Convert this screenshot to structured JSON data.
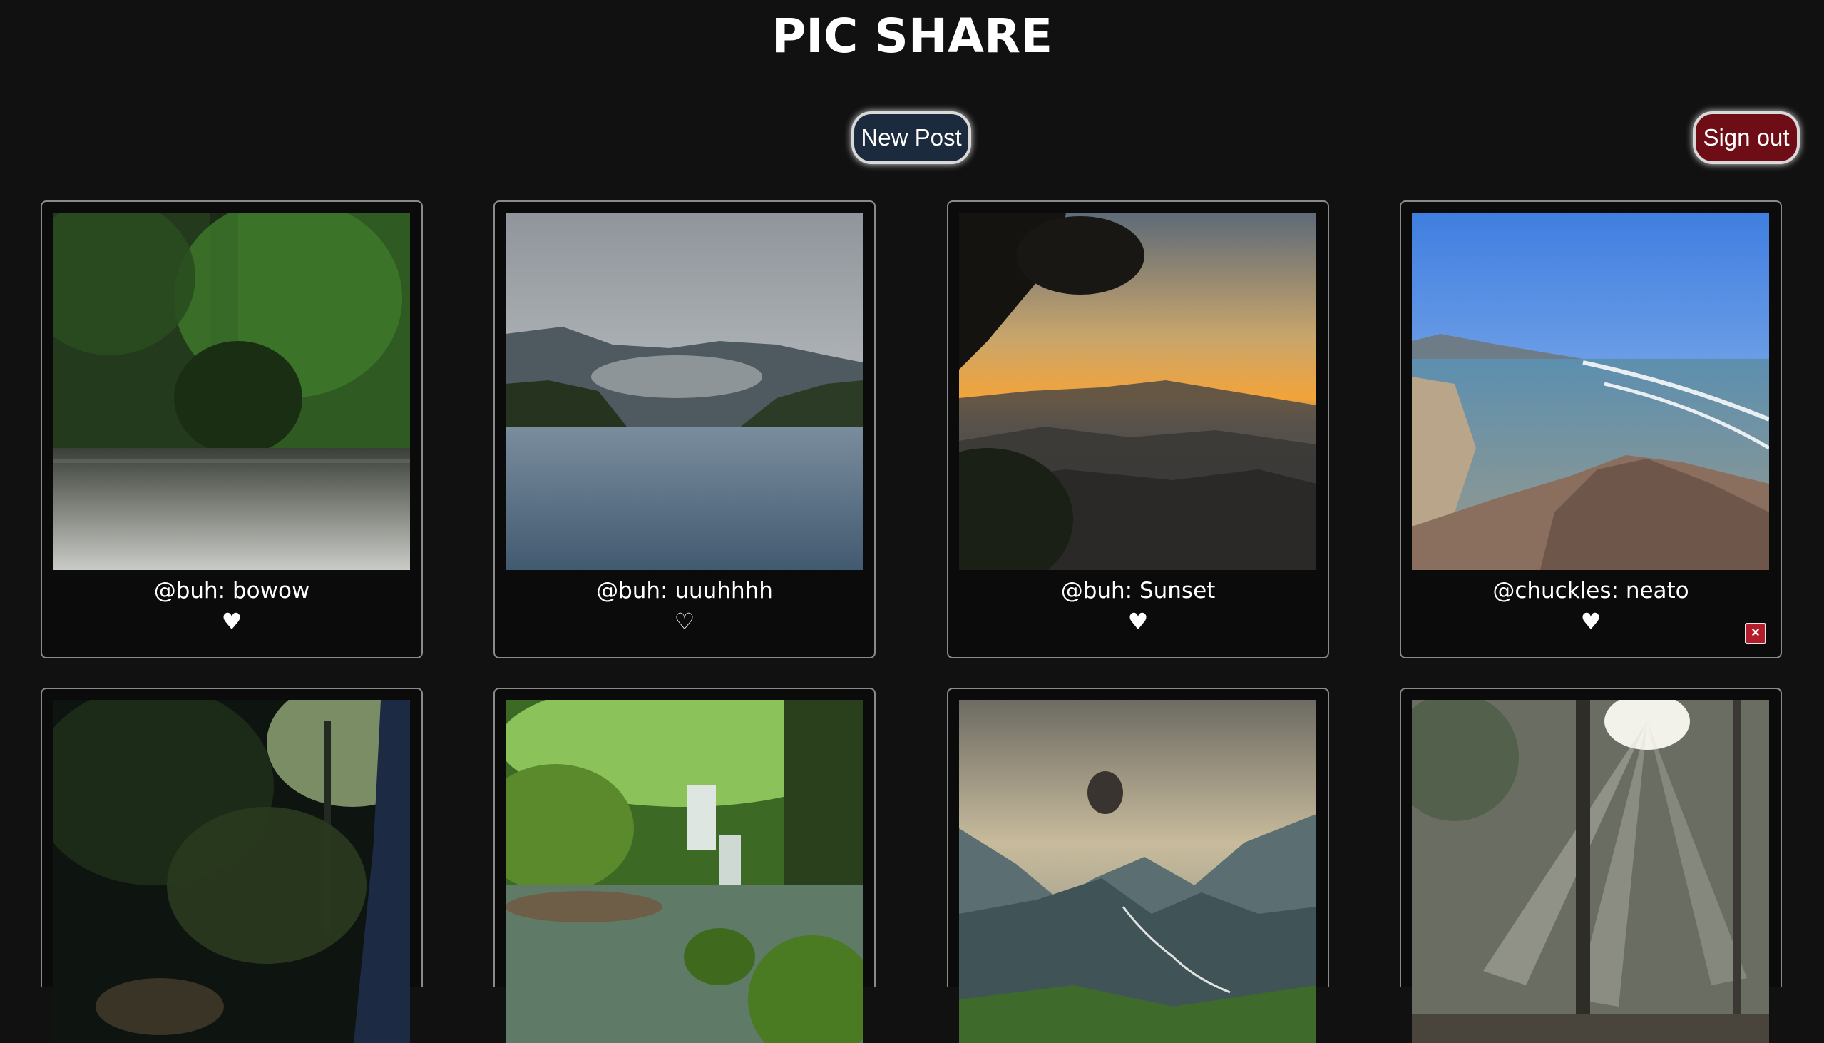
{
  "header": {
    "title": "PIC SHARE"
  },
  "toolbar": {
    "new_post_label": "New Post",
    "sign_out_label": "Sign out"
  },
  "posts": [
    {
      "caption": "@buh: bowow",
      "liked": true,
      "heart": "♥",
      "scene": "jungle river"
    },
    {
      "caption": "@buh: uuuhhhh",
      "liked": false,
      "heart": "♡",
      "scene": "misty lake"
    },
    {
      "caption": "@buh: Sunset",
      "liked": true,
      "heart": "♥",
      "scene": "mountain sunset"
    },
    {
      "caption": "@chuckles: neato",
      "liked": true,
      "heart": "♥",
      "scene": "coastal beach",
      "delete_label": "×"
    },
    {
      "caption": "",
      "scene": "dark forest path"
    },
    {
      "caption": "",
      "scene": "mossy waterfall"
    },
    {
      "caption": "",
      "scene": "valley with sun rays"
    },
    {
      "caption": "",
      "scene": "forest with light beams"
    }
  ],
  "colors": {
    "background": "#111111",
    "new_post_button": "#1b2b3d",
    "sign_out_button": "#6e0d16",
    "delete_button": "#b31d2b",
    "card_border": "#8a8a8a"
  },
  "icons": {
    "like": "heart-icon",
    "delete": "close-icon"
  }
}
